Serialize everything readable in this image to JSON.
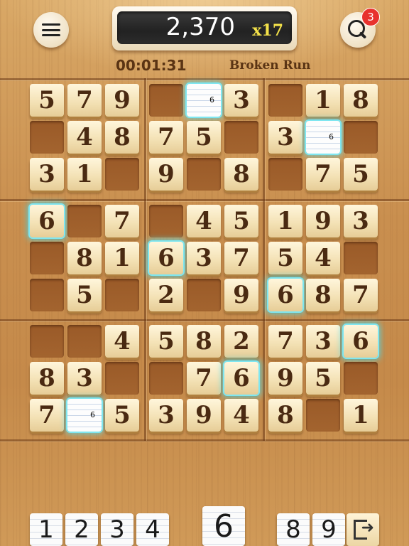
{
  "header": {
    "score": "2,370",
    "multiplier": "x17",
    "notification_count": "3",
    "timer": "00:01:31",
    "mode": "Broken Run"
  },
  "colors": {
    "highlight": "#7fe6f0",
    "badge": "#e8322e",
    "multiplier": "#f4e24a"
  },
  "grid": [
    [
      "5",
      "7",
      "9",
      "",
      "n6",
      "3",
      "",
      "1",
      "8"
    ],
    [
      "",
      "4",
      "8",
      "7",
      "5",
      "",
      "3",
      "n6",
      ""
    ],
    [
      "3",
      "1",
      "",
      "9",
      "",
      "8",
      "",
      "7",
      "5"
    ],
    [
      "*6",
      "",
      "7",
      "",
      "4",
      "5",
      "1",
      "9",
      "3"
    ],
    [
      "",
      "8",
      "1",
      "*6",
      "3",
      "7",
      "5",
      "4",
      ""
    ],
    [
      "",
      "5",
      "",
      "2",
      "",
      "9",
      "*6",
      "8",
      "7"
    ],
    [
      "",
      "",
      "4",
      "5",
      "8",
      "2",
      "7",
      "3",
      "*6"
    ],
    [
      "8",
      "3",
      "",
      "",
      "7",
      "*6",
      "9",
      "5",
      ""
    ],
    [
      "7",
      "n6",
      "5",
      "3",
      "9",
      "4",
      "8",
      "",
      "1"
    ]
  ],
  "number_pad": [
    {
      "label": "1",
      "selected": false
    },
    {
      "label": "2",
      "selected": false
    },
    {
      "label": "3",
      "selected": false
    },
    {
      "label": "4",
      "selected": false
    },
    {
      "label": "6",
      "selected": true
    },
    {
      "label": "8",
      "selected": false
    },
    {
      "label": "9",
      "selected": false
    }
  ],
  "icons": {
    "menu": "menu-icon",
    "search": "search-icon",
    "exit": "exit-icon"
  }
}
